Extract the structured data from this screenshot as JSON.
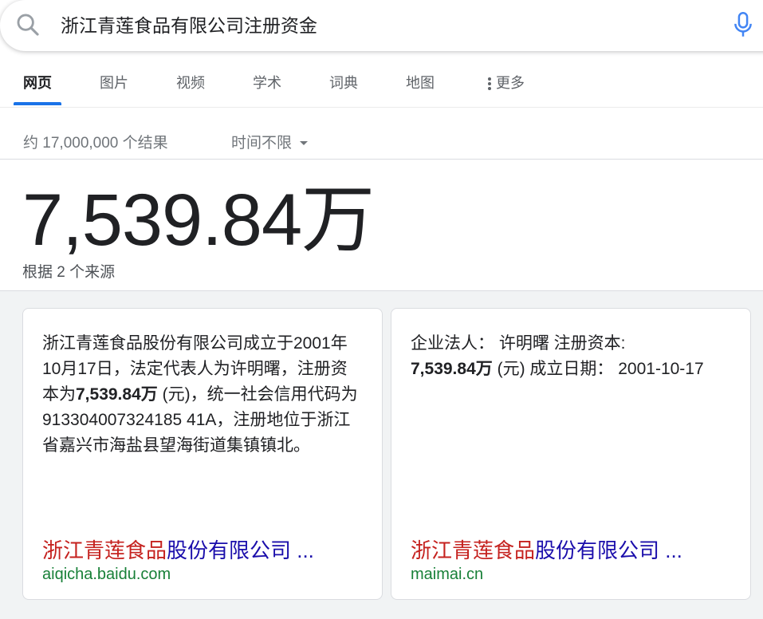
{
  "search": {
    "query": "浙江青莲食品有限公司注册资金"
  },
  "tabs": [
    {
      "label": "网页",
      "active": true
    },
    {
      "label": "图片"
    },
    {
      "label": "视频"
    },
    {
      "label": "学术"
    },
    {
      "label": "词典"
    },
    {
      "label": "地图"
    },
    {
      "label": "更多"
    }
  ],
  "stats": {
    "result_count": "约 17,000,000 个结果",
    "time_filter": "时间不限"
  },
  "answer": {
    "value": "7,539.84万",
    "source_count": "根据 2 个来源"
  },
  "cards": [
    {
      "snippet_pre": "浙江青莲食品股份有限公司成立于2001年10月17日，法定代表人为许明曙，注册资本为",
      "snippet_bold": "7,539.84万",
      "snippet_post": " (元)，统一社会信用代码为913304007324185 41A，注册地位于浙江省嘉兴市海盐县望海街道集镇镇北。",
      "link_highlight": "浙江青莲食品",
      "link_rest": "股份有限公司 ...",
      "url": "aiqicha.baidu.com"
    },
    {
      "snippet_pre": "企业法人： 许明曙 注册资本: ",
      "snippet_bold": "7,539.84万",
      "snippet_post": " (元) 成立日期： 2001-10-17",
      "link_highlight": "浙江青莲食品",
      "link_rest": "股份有限公司 ...",
      "url": "maimai.cn"
    }
  ],
  "colors": {
    "accent": "#1a73e8",
    "link": "#1a0dab",
    "link_highlight": "#c5221f",
    "url": "#188038"
  }
}
